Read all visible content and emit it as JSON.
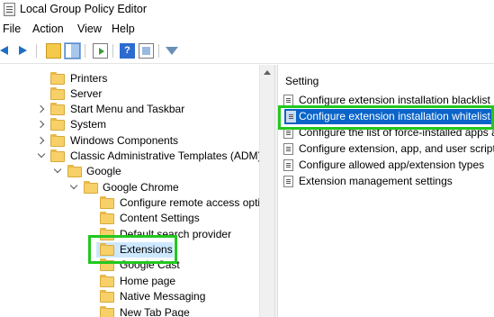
{
  "window": {
    "title": "Local Group Policy Editor"
  },
  "menu": [
    "File",
    "Action",
    "View",
    "Help"
  ],
  "toolbar": {
    "icons": [
      "back-arrow-icon",
      "forward-arrow-icon",
      "up-folder-icon",
      "show-hide-tree-icon",
      "export-list-icon",
      "help-icon",
      "properties-icon",
      "filter-icon"
    ],
    "help_glyph": "?"
  },
  "tree": {
    "items": [
      {
        "label": "Printers",
        "expander": "none"
      },
      {
        "label": "Server",
        "expander": "none"
      },
      {
        "label": "Start Menu and Taskbar",
        "expander": "collapsed"
      },
      {
        "label": "System",
        "expander": "collapsed"
      },
      {
        "label": "Windows Components",
        "expander": "collapsed"
      },
      {
        "label": "Classic Administrative Templates (ADM)",
        "expander": "expanded"
      },
      {
        "label": "Google",
        "expander": "expanded"
      },
      {
        "label": "Google Chrome",
        "expander": "expanded"
      },
      {
        "label": "Configure remote access optio",
        "expander": "none"
      },
      {
        "label": "Content Settings",
        "expander": "none"
      },
      {
        "label": "Default search provider",
        "expander": "none"
      },
      {
        "label": "Extensions",
        "expander": "none",
        "selected": true
      },
      {
        "label": "Google Cast",
        "expander": "none"
      },
      {
        "label": "Home page",
        "expander": "none"
      },
      {
        "label": "Native Messaging",
        "expander": "none"
      },
      {
        "label": "New Tab Page",
        "expander": "none"
      }
    ]
  },
  "settings": {
    "column_header": "Setting",
    "rows": [
      {
        "label": "Configure extension installation blacklist"
      },
      {
        "label": "Configure extension installation whitelist",
        "selected": true
      },
      {
        "label": "Configure the list of force-installed apps an"
      },
      {
        "label": "Configure extension, app, and user script in"
      },
      {
        "label": "Configure allowed app/extension types"
      },
      {
        "label": "Extension management settings"
      }
    ]
  },
  "highlight_color": "#22c81f",
  "selection_color": "#0a64c9"
}
